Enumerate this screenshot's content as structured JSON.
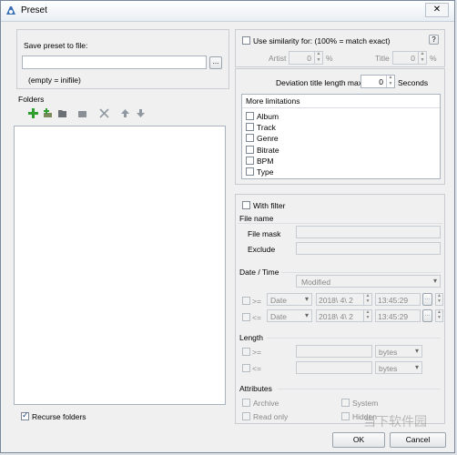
{
  "window": {
    "title": "Preset",
    "close_glyph": "✕"
  },
  "save": {
    "label": "Save preset to file:",
    "value": "",
    "browse": "...",
    "hint": "(empty = inifile)"
  },
  "folders": {
    "label": "Folders",
    "recurse": "Recurse folders",
    "recurse_checked": true
  },
  "similarity": {
    "label": "Use similarity for: (100% = match exact)",
    "help": "?",
    "artist_label": "Artist",
    "artist_value": "0",
    "title_label": "Title",
    "title_value": "0",
    "percent": "%"
  },
  "deviation": {
    "label": "Deviation title length max.",
    "value": "0",
    "unit": "Seconds"
  },
  "limitations": {
    "header": "More limitations",
    "items": [
      "Album",
      "Track",
      "Genre",
      "Bitrate",
      "BPM",
      "Type"
    ]
  },
  "filter": {
    "label": "With filter",
    "filename_header": "File name",
    "file_mask": "File mask",
    "exclude": "Exclude"
  },
  "datetime": {
    "header": "Date / Time",
    "mode": "Modified",
    "rows": [
      {
        "op": ">=",
        "kind": "Date",
        "date": "2018\\  4\\  2",
        "time": "13:45:29",
        "btn": "..."
      },
      {
        "op": "<=",
        "kind": "Date",
        "date": "2018\\  4\\  2",
        "time": "13:45:29",
        "btn": "..."
      }
    ]
  },
  "length": {
    "header": "Length",
    "rows": [
      {
        "op": ">=",
        "unit": "bytes"
      },
      {
        "op": "<=",
        "unit": "bytes"
      }
    ]
  },
  "attributes": {
    "header": "Attributes",
    "archive": "Archive",
    "system": "System",
    "readonly": "Read only",
    "hidden": "Hidden"
  },
  "buttons": {
    "ok": "OK",
    "cancel": "Cancel"
  },
  "watermark": "当下软件园",
  "colors": {
    "accent": "#1b3e7a",
    "toolbar_add": "#2e9e2e"
  }
}
